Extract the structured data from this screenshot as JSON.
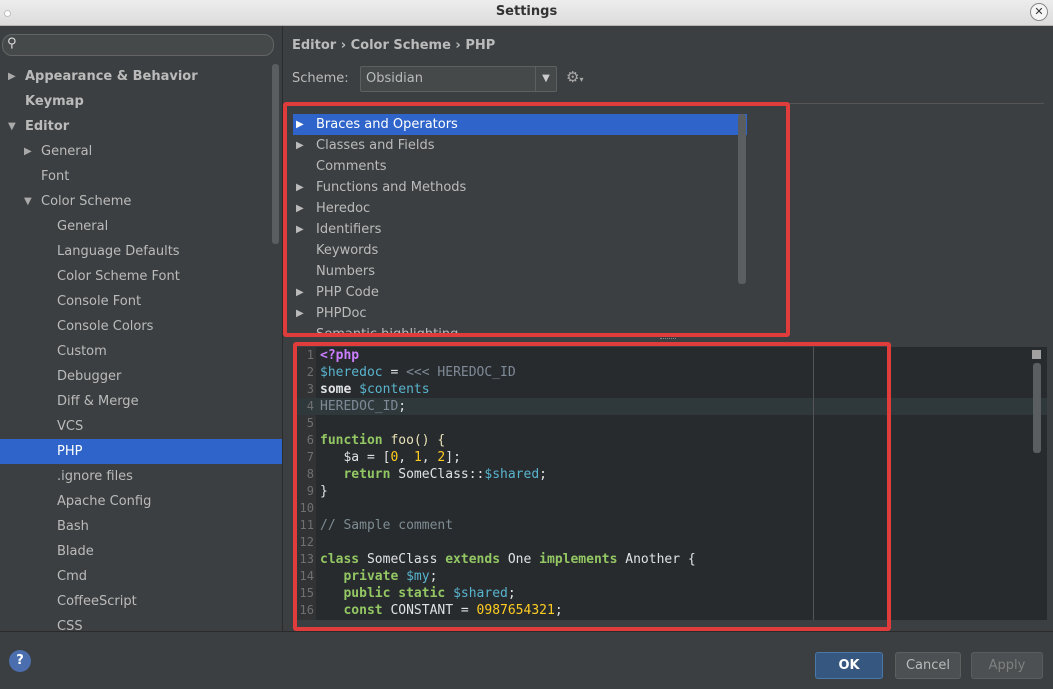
{
  "window": {
    "title": "Settings"
  },
  "sidebar": {
    "items": [
      {
        "label": "Appearance & Behavior",
        "level": 0,
        "arrow": "right",
        "bold": true
      },
      {
        "label": "Keymap",
        "level": 0,
        "arrow": "",
        "bold": true
      },
      {
        "label": "Editor",
        "level": 0,
        "arrow": "down",
        "bold": true
      },
      {
        "label": "General",
        "level": 1,
        "arrow": "right",
        "bold": false
      },
      {
        "label": "Font",
        "level": 1,
        "arrow": "",
        "bold": false
      },
      {
        "label": "Color Scheme",
        "level": 1,
        "arrow": "down",
        "bold": false
      },
      {
        "label": "General",
        "level": 2,
        "arrow": "",
        "bold": false
      },
      {
        "label": "Language Defaults",
        "level": 2,
        "arrow": "",
        "bold": false
      },
      {
        "label": "Color Scheme Font",
        "level": 2,
        "arrow": "",
        "bold": false
      },
      {
        "label": "Console Font",
        "level": 2,
        "arrow": "",
        "bold": false
      },
      {
        "label": "Console Colors",
        "level": 2,
        "arrow": "",
        "bold": false
      },
      {
        "label": "Custom",
        "level": 2,
        "arrow": "",
        "bold": false
      },
      {
        "label": "Debugger",
        "level": 2,
        "arrow": "",
        "bold": false
      },
      {
        "label": "Diff & Merge",
        "level": 2,
        "arrow": "",
        "bold": false
      },
      {
        "label": "VCS",
        "level": 2,
        "arrow": "",
        "bold": false
      },
      {
        "label": "PHP",
        "level": 2,
        "arrow": "",
        "bold": false,
        "selected": true
      },
      {
        "label": ".ignore files",
        "level": 2,
        "arrow": "",
        "bold": false
      },
      {
        "label": "Apache Config",
        "level": 2,
        "arrow": "",
        "bold": false
      },
      {
        "label": "Bash",
        "level": 2,
        "arrow": "",
        "bold": false
      },
      {
        "label": "Blade",
        "level": 2,
        "arrow": "",
        "bold": false
      },
      {
        "label": "Cmd",
        "level": 2,
        "arrow": "",
        "bold": false
      },
      {
        "label": "CoffeeScript",
        "level": 2,
        "arrow": "",
        "bold": false
      },
      {
        "label": "CSS",
        "level": 2,
        "arrow": "",
        "bold": false
      }
    ]
  },
  "breadcrumb": {
    "text": "Editor › Color Scheme › PHP"
  },
  "scheme": {
    "label": "Scheme:",
    "value": "Obsidian"
  },
  "categories": [
    {
      "label": "Braces and Operators",
      "expandable": true,
      "selected": true
    },
    {
      "label": "Classes and Fields",
      "expandable": true
    },
    {
      "label": "Comments",
      "expandable": false
    },
    {
      "label": "Functions and Methods",
      "expandable": true
    },
    {
      "label": "Heredoc",
      "expandable": true
    },
    {
      "label": "Identifiers",
      "expandable": true
    },
    {
      "label": "Keywords",
      "expandable": false
    },
    {
      "label": "Numbers",
      "expandable": false
    },
    {
      "label": "PHP Code",
      "expandable": true
    },
    {
      "label": "PHPDoc",
      "expandable": true
    },
    {
      "label": "Semantic highlighting",
      "expandable": false
    }
  ],
  "code": {
    "current_line": 4,
    "lines": [
      [
        [
          "<?php",
          "c-php"
        ]
      ],
      [
        [
          "$heredoc",
          "c-var"
        ],
        [
          " = ",
          "c-op"
        ],
        [
          "<<< HEREDOC_ID",
          "c-hid"
        ]
      ],
      [
        [
          "some ",
          "c-txt"
        ],
        [
          "$contents",
          "c-var"
        ]
      ],
      [
        [
          "HEREDOC_ID",
          "c-hid"
        ],
        [
          ";",
          "c-op"
        ]
      ],
      [],
      [
        [
          "function",
          "c-kw"
        ],
        [
          " foo() {",
          "c-fn"
        ]
      ],
      [
        [
          "   $a = [",
          "c-op"
        ],
        [
          "0",
          "c-num"
        ],
        [
          ", ",
          "c-op"
        ],
        [
          "1",
          "c-num"
        ],
        [
          ", ",
          "c-op"
        ],
        [
          "2",
          "c-num"
        ],
        [
          "];",
          "c-op"
        ]
      ],
      [
        [
          "   ",
          "c-op"
        ],
        [
          "return",
          "c-kw"
        ],
        [
          " SomeClass::",
          "c-cls"
        ],
        [
          "$shared",
          "c-var"
        ],
        [
          ";",
          "c-op"
        ]
      ],
      [
        [
          "}",
          "c-op"
        ]
      ],
      [],
      [
        [
          "// Sample comment",
          "c-cmt"
        ]
      ],
      [],
      [
        [
          "class",
          "c-kw"
        ],
        [
          " SomeClass ",
          "c-cls"
        ],
        [
          "extends",
          "c-kw"
        ],
        [
          " One ",
          "c-cls"
        ],
        [
          "implements",
          "c-kw"
        ],
        [
          " Another {",
          "c-cls"
        ]
      ],
      [
        [
          "   ",
          "c-op"
        ],
        [
          "private",
          "c-kw"
        ],
        [
          " ",
          "c-op"
        ],
        [
          "$my",
          "c-var"
        ],
        [
          ";",
          "c-op"
        ]
      ],
      [
        [
          "   ",
          "c-op"
        ],
        [
          "public static",
          "c-kw"
        ],
        [
          " ",
          "c-op"
        ],
        [
          "$shared",
          "c-var"
        ],
        [
          ";",
          "c-op"
        ]
      ],
      [
        [
          "   ",
          "c-op"
        ],
        [
          "const",
          "c-kw"
        ],
        [
          " CONSTANT = ",
          "c-op"
        ],
        [
          "0987654321",
          "c-num"
        ],
        [
          ";",
          "c-op"
        ]
      ]
    ]
  },
  "buttons": {
    "ok": "OK",
    "cancel": "Cancel",
    "apply": "Apply",
    "help": "?"
  },
  "colors": {
    "highlight": "#e03c3c",
    "selection": "#2f65ca"
  }
}
